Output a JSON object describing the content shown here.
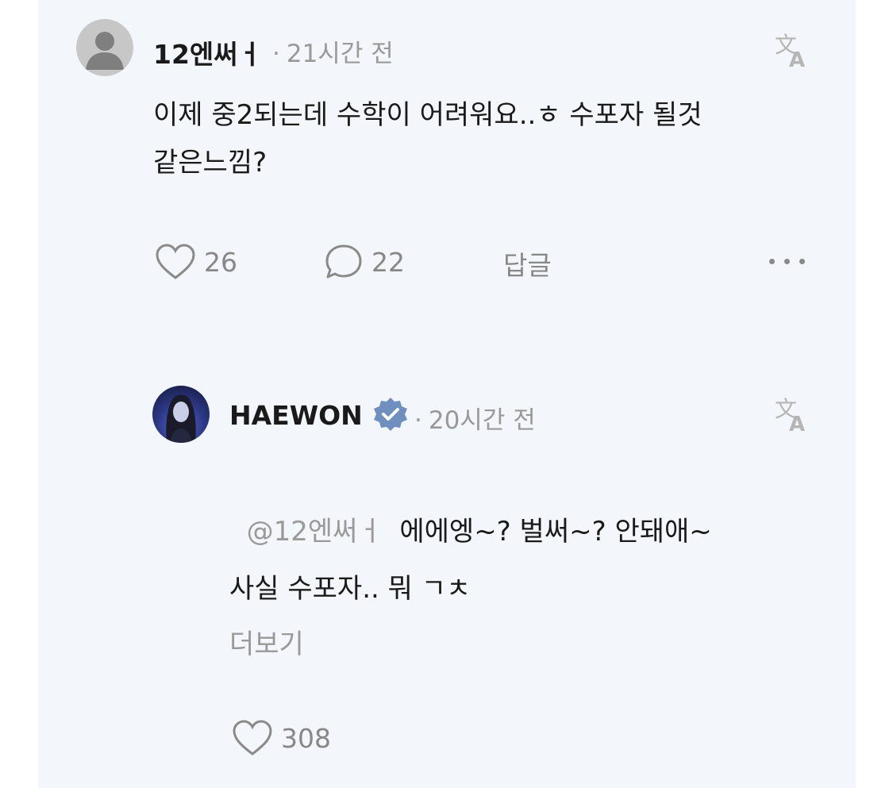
{
  "comment": {
    "username": "12엔써ㅓ",
    "time": "21시간 전",
    "text": "이제 중2되는데 수학이 어려워요..ㅎ 수포자 될것\n같은느낌?",
    "likes": "26",
    "replies": "22",
    "reply_label": "답글"
  },
  "reply": {
    "username": "HAEWON",
    "time": "20시간 전",
    "mention": "@12엔써ㅓ",
    "text_line1": "에에엥~? 벌써~? 안돼애~",
    "text_line2": "사실 수포자.. 뭐 ㄱㅊ",
    "more_label": "더보기",
    "likes": "308"
  },
  "colors": {
    "background": "#f3f6fa",
    "verified_badge": "#6f8fbf",
    "muted": "#999999"
  },
  "icons": {
    "translate": "translate-icon",
    "heart": "heart-icon",
    "comment": "comment-bubble-icon",
    "more": "more-dots-icon",
    "verified": "verified-badge-icon"
  }
}
